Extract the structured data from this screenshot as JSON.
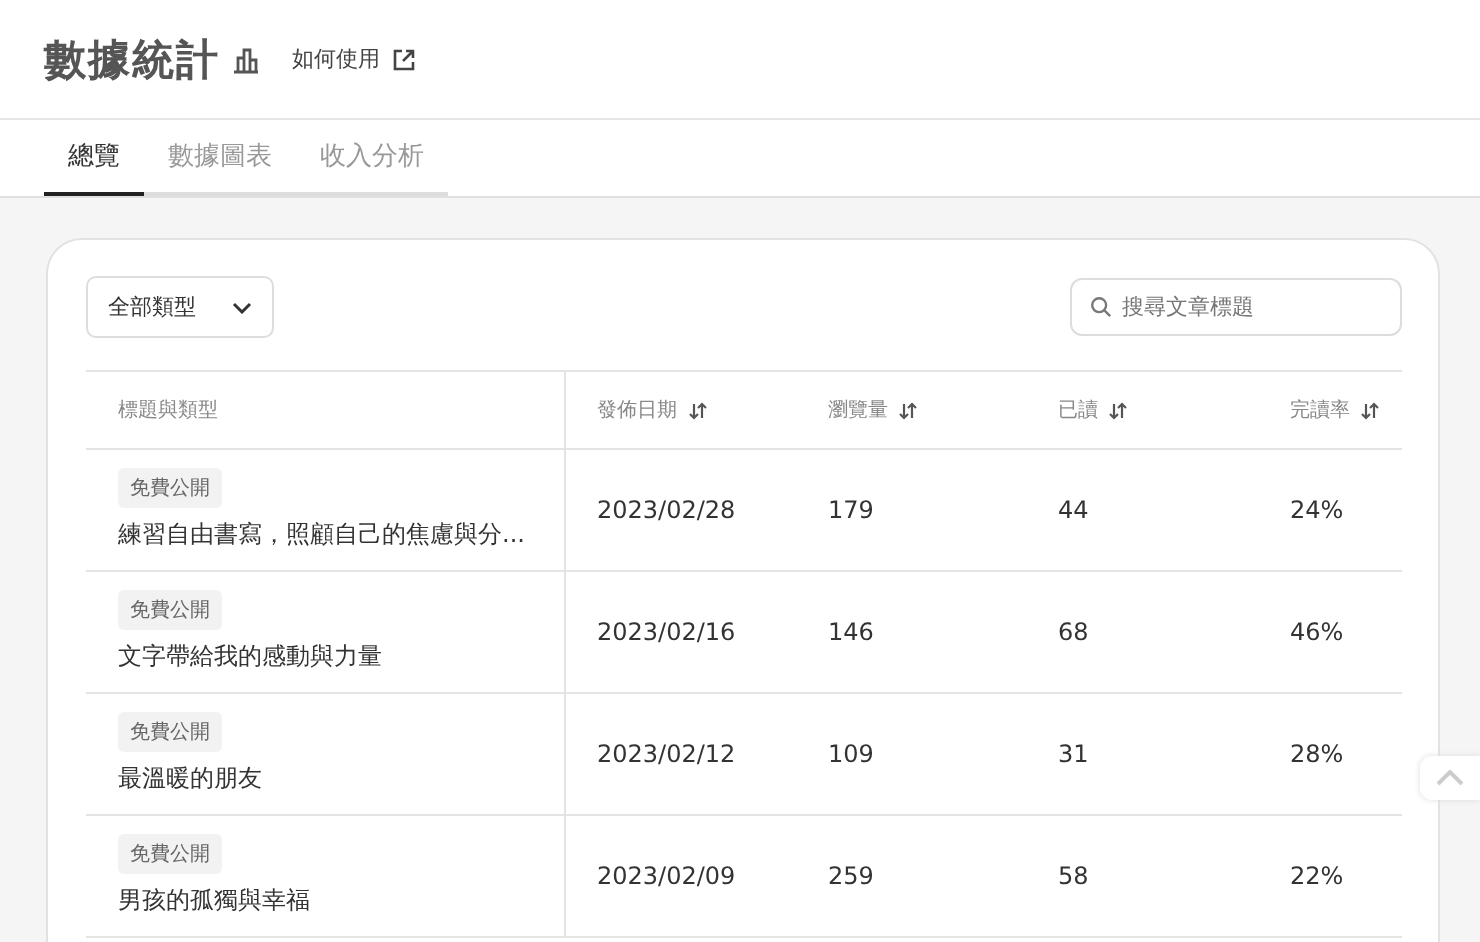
{
  "header": {
    "title": "數據統計",
    "help_link": "如何使用"
  },
  "tabs": [
    {
      "label": "總覽",
      "selected": true
    },
    {
      "label": "數據圖表",
      "selected": false
    },
    {
      "label": "收入分析",
      "selected": false
    }
  ],
  "filter": {
    "value": "全部類型"
  },
  "search": {
    "placeholder": "搜尋文章標題"
  },
  "table": {
    "columns": [
      {
        "label": "標題與類型",
        "sortable": false
      },
      {
        "label": "發佈日期",
        "sortable": true
      },
      {
        "label": "瀏覽量",
        "sortable": true
      },
      {
        "label": "已讀",
        "sortable": true
      },
      {
        "label": "完讀率",
        "sortable": true
      }
    ],
    "rows": [
      {
        "tag": "免費公開",
        "title": "練習自由書寫，照顧自己的焦慮與分...",
        "date": "2023/02/28",
        "views": "179",
        "read": "44",
        "rate": "24%"
      },
      {
        "tag": "免費公開",
        "title": "文字帶給我的感動與力量",
        "date": "2023/02/16",
        "views": "146",
        "read": "68",
        "rate": "46%"
      },
      {
        "tag": "免費公開",
        "title": "最溫暖的朋友",
        "date": "2023/02/12",
        "views": "109",
        "read": "31",
        "rate": "28%"
      },
      {
        "tag": "免費公開",
        "title": "男孩的孤獨與幸福",
        "date": "2023/02/09",
        "views": "259",
        "read": "58",
        "rate": "22%"
      }
    ]
  }
}
